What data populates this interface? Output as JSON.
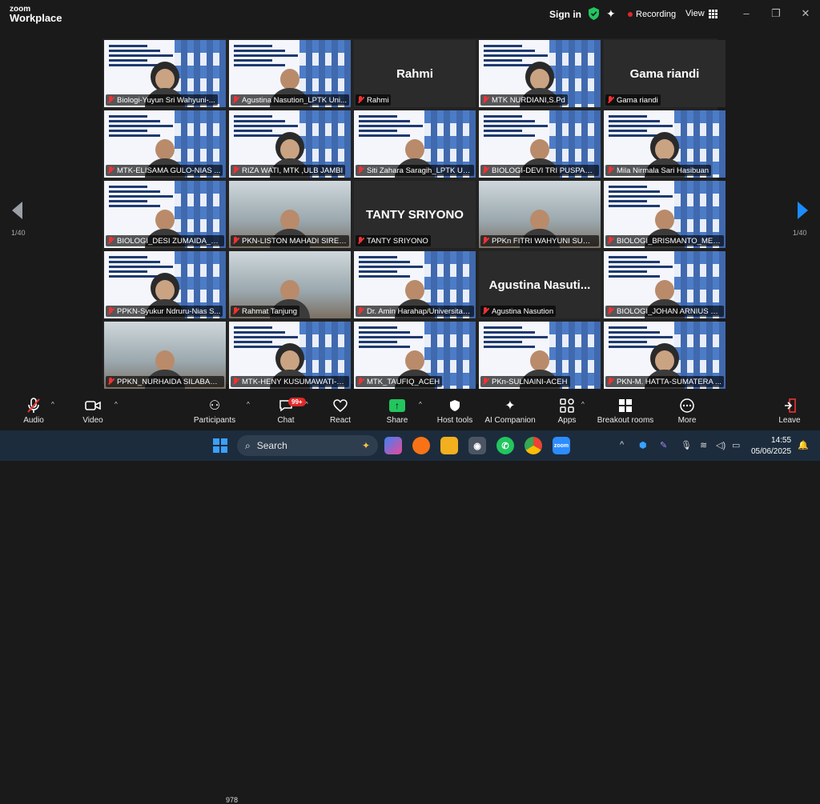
{
  "window": {
    "logo_line1": "zoom",
    "logo_line2": "Workplace",
    "sign_in": "Sign in",
    "recording": "Recording",
    "view": "View"
  },
  "gallery": {
    "page_left": "1/40",
    "page_right": "1/40",
    "tiles": [
      {
        "name": "Biologi-Yuyun Sri Wahyuni-...",
        "type": "slide",
        "muted": true
      },
      {
        "name": "Agustina Nasution_LPTK Uni...",
        "type": "slide",
        "muted": true
      },
      {
        "name": "Rahmi",
        "type": "name",
        "big": "Rahmi",
        "muted": true
      },
      {
        "name": "MTK NURDIANI,S.Pd",
        "type": "slide",
        "muted": true
      },
      {
        "name": "Gama riandi",
        "type": "name",
        "big": "Gama riandi",
        "muted": true
      },
      {
        "name": "MTK-ELISAMA GULO-NIAS ...",
        "type": "slide",
        "muted": true
      },
      {
        "name": "RIZA WATI, MTK ,ULB JAMBI",
        "type": "slide",
        "muted": true
      },
      {
        "name": "Siti Zahara Saragih_LPTK ULB",
        "type": "slide",
        "muted": true
      },
      {
        "name": "BIOLOGI-DEVI TRI PUSPAND...",
        "type": "slide",
        "muted": true
      },
      {
        "name": "Mila Nirmala Sari Hasibuan",
        "type": "slide",
        "muted": true
      },
      {
        "name": "BIOLOGI_DESI ZUMAIDA_JA...",
        "type": "slide",
        "muted": true
      },
      {
        "name": "PKN-LISTON MAHADI SIREG...",
        "type": "photo",
        "muted": true
      },
      {
        "name": "TANTY SRIYONO",
        "type": "name",
        "big": "TANTY SRIYONO",
        "muted": true
      },
      {
        "name": "PPKn FITRI WAHYUNI SUMA...",
        "type": "photo",
        "muted": true
      },
      {
        "name": "BIOLOGI_BRISMANTO_MERA...",
        "type": "slide",
        "muted": true
      },
      {
        "name": "PPKN-Syukur Ndruru-Nias S...",
        "type": "slide",
        "muted": true
      },
      {
        "name": "Rahmat Tanjung",
        "type": "photo",
        "muted": true
      },
      {
        "name": "Dr. Amin Harahap/Universitas L...",
        "type": "slide",
        "muted": true,
        "speaking": true
      },
      {
        "name": "Agustina Nasution",
        "type": "name",
        "big": "Agustina  Nasuti...",
        "muted": true
      },
      {
        "name": "BIOLOGI_JOHAN ARNIUS LA...",
        "type": "slide",
        "muted": true
      },
      {
        "name": "PPKN_NURHAIDA SILABAN_...",
        "type": "photo",
        "muted": true
      },
      {
        "name": "MTK-HENY KUSUMAWATI-L...",
        "type": "slide",
        "muted": true
      },
      {
        "name": "MTK_TAUFIQ_ACEH",
        "type": "slide",
        "muted": true
      },
      {
        "name": "PKn-SULNAINI-ACEH",
        "type": "slide",
        "muted": true
      },
      {
        "name": "PKN-M. HATTA-SUMATERA ...",
        "type": "slide",
        "muted": true
      }
    ]
  },
  "toolbar": {
    "audio": "Audio",
    "video": "Video",
    "participants": "Participants",
    "participants_count": "978",
    "chat": "Chat",
    "chat_badge": "99+",
    "react": "React",
    "share": "Share",
    "host_tools": "Host tools",
    "ai_companion": "AI Companion",
    "apps": "Apps",
    "breakout_rooms": "Breakout rooms",
    "more": "More",
    "leave": "Leave"
  },
  "taskbar": {
    "search": "Search",
    "time": "14:55",
    "date": "05/06/2025"
  }
}
